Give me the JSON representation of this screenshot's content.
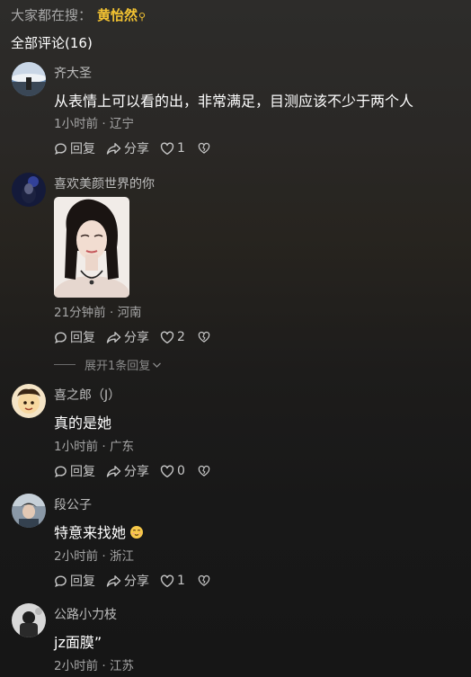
{
  "search_hint": {
    "label": "大家都在搜：",
    "keyword": "黄怡然",
    "icon": "search-icon"
  },
  "comments_header": {
    "title": "全部评论(16)"
  },
  "comments": [
    {
      "username": "齐大圣",
      "text": "从表情上可以看的出，非常满足，目测应该不少于两个人",
      "time": "1小时前",
      "location": "辽宁",
      "reply_label": "回复",
      "share_label": "分享",
      "likes": "1"
    },
    {
      "username": "喜欢美颜世界的你",
      "text": "",
      "time": "21分钟前",
      "location": "河南",
      "reply_label": "回复",
      "share_label": "分享",
      "likes": "2",
      "expand_label": "展开1条回复"
    },
    {
      "username": "喜之郎（J）",
      "text": "真的是她",
      "time": "1小时前",
      "location": "广东",
      "reply_label": "回复",
      "share_label": "分享",
      "likes": "0"
    },
    {
      "username": "段公子",
      "text": "特意来找她",
      "time": "2小时前",
      "location": "浙江",
      "reply_label": "回复",
      "share_label": "分享",
      "likes": "1"
    },
    {
      "username": "公路小力枝",
      "text": "jz面膜”",
      "time": "2小时前",
      "location": "江苏"
    }
  ],
  "meta_separator": " · ",
  "colors": {
    "keyword": "#f3c332",
    "background": "#1e1d1c",
    "meta": "#a6a6a6"
  }
}
